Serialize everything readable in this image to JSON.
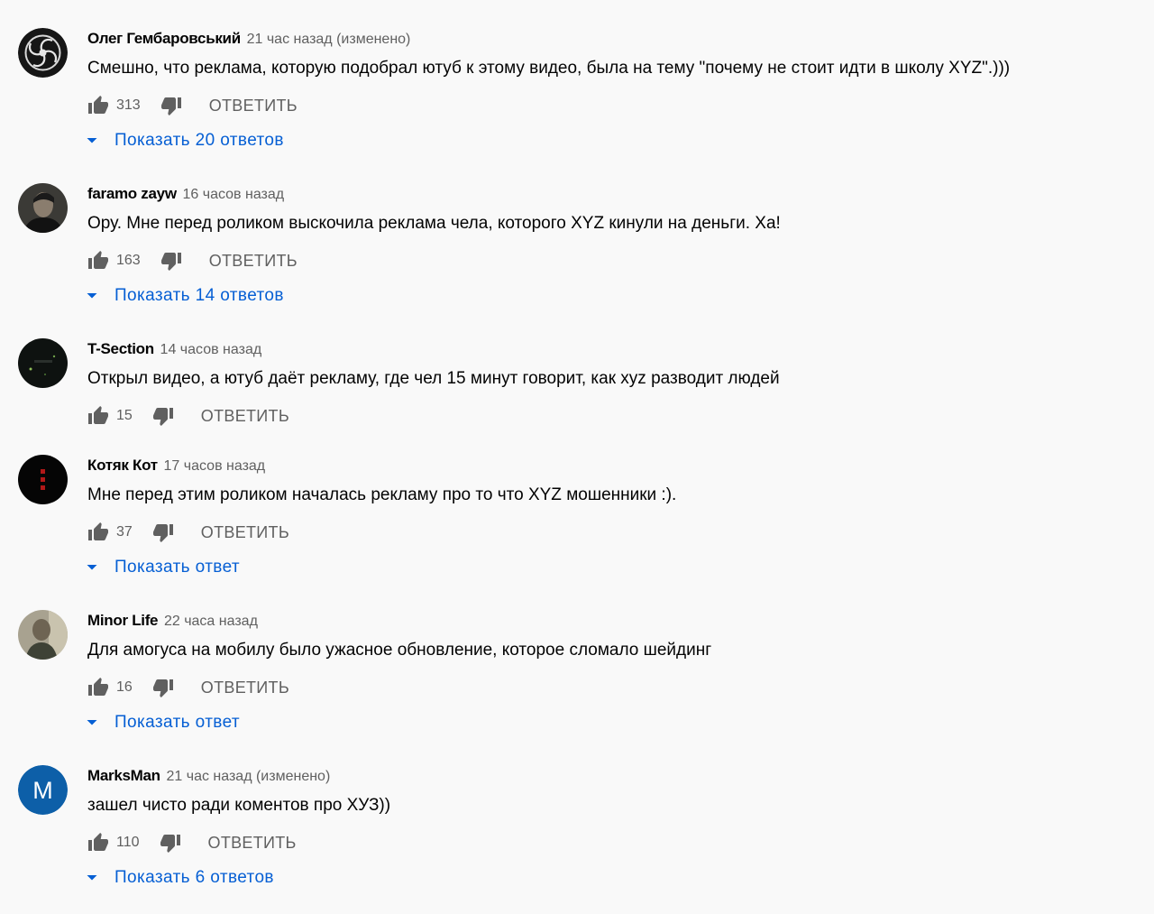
{
  "reply_label": "ОТВЕТИТЬ",
  "colors": {
    "background": "#f9f9f9",
    "link": "#065fd4",
    "secondary_text": "#606060"
  },
  "comments": [
    {
      "author": "Олег Гембаровський",
      "time": "21 час назад (изменено)",
      "text": "Смешно, что реклама, которую подобрал ютуб к этому видео, была на тему \"почему не стоит идти в школу XYZ\".)))",
      "likes": "313",
      "replies_label": "Показать 20 ответов"
    },
    {
      "author": "faramo zayw",
      "time": "16 часов назад",
      "text": "Ору. Мне перед роликом выскочила реклама чела, которого XYZ кинули на деньги. Ха!",
      "likes": "163",
      "replies_label": "Показать 14 ответов"
    },
    {
      "author": "T-Section",
      "time": "14 часов назад",
      "text": "Открыл видео, а ютуб даёт рекламу, где чел 15 минут говорит, как xyz разводит людей",
      "likes": "15"
    },
    {
      "author": "Котяк Кот",
      "time": "17 часов назад",
      "text": "Мне перед этим роликом началась рекламу про то что XYZ мошенники :).",
      "likes": "37",
      "replies_label": "Показать ответ"
    },
    {
      "author": "Minor Life",
      "time": "22 часа назад",
      "text": "Для амогуса на мобилу было ужасное обновление, которое сломало шейдинг",
      "likes": "16",
      "replies_label": "Показать ответ"
    },
    {
      "author": "MarksMan",
      "time": "21 час назад (изменено)",
      "text": "зашел чисто ради коментов про ХУЗ))",
      "likes": "110",
      "replies_label": "Показать 6 ответов",
      "avatar_letter": "M",
      "avatar_color": "#0d5fa8"
    }
  ]
}
